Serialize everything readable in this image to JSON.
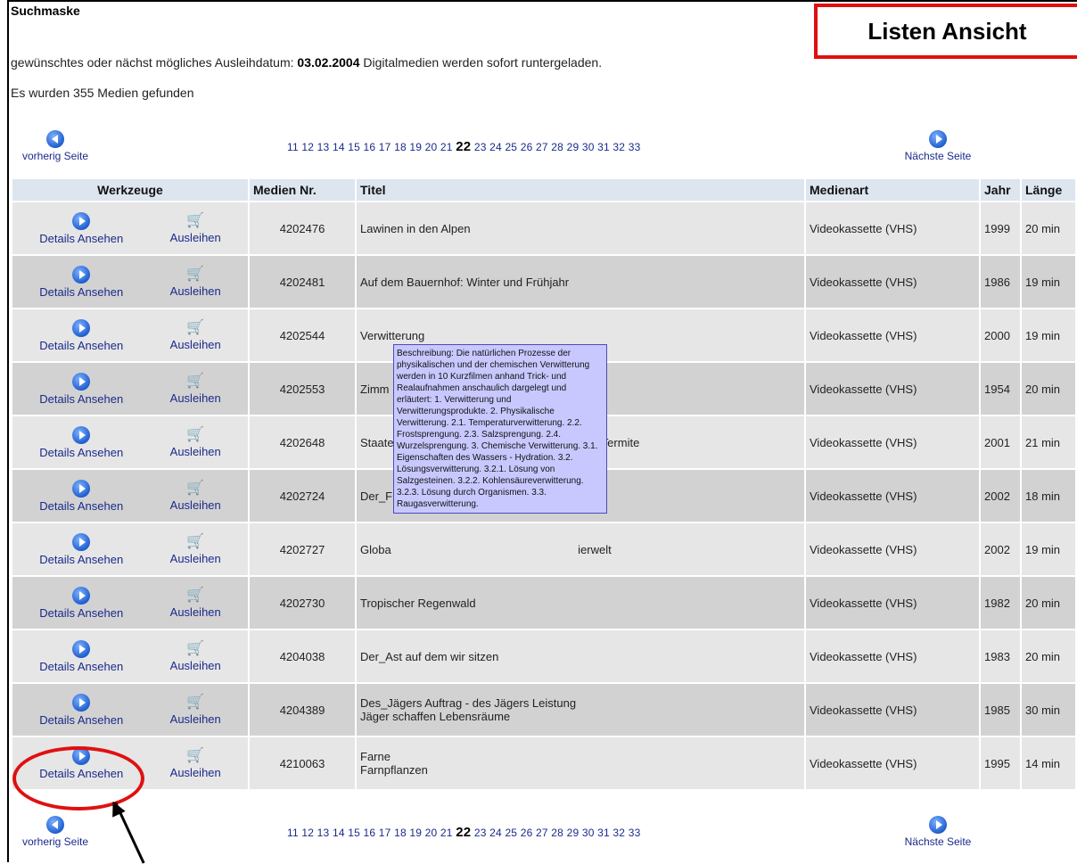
{
  "header": {
    "title": "Suchmaske",
    "view_label": "Listen Ansicht",
    "info_prefix": "gewünschtes oder nächst mögliches Ausleihdatum:",
    "info_date": "03.02.2004",
    "info_suffix": "Digitalmedien werden sofort runtergeladen.",
    "result_count": "Es wurden 355 Medien gefunden"
  },
  "pagination": {
    "prev_label": "vorherig Seite",
    "next_label": "Nächste Seite",
    "pages_before": "11 12 13 14 15 16 17 18 19 20 21",
    "current": "22",
    "pages_after": "23 24 25 26 27 28 29 30 31 32 33"
  },
  "table": {
    "headers": {
      "werkzeuge": "Werkzeuge",
      "nr": "Medien Nr.",
      "titel": "Titel",
      "art": "Medienart",
      "jahr": "Jahr",
      "laenge": "Länge"
    },
    "details_label": "Details Ansehen",
    "ausleihen_label": "Ausleihen",
    "rows": [
      {
        "nr": "4202476",
        "titel": "Lawinen in den Alpen",
        "titel2": "",
        "art": "Videokassette (VHS)",
        "jahr": "1999",
        "laenge": "20 min"
      },
      {
        "nr": "4202481",
        "titel": "Auf dem Bauernhof: Winter und Frühjahr",
        "titel2": "",
        "art": "Videokassette (VHS)",
        "jahr": "1986",
        "laenge": "19 min"
      },
      {
        "nr": "4202544",
        "titel": "Verwitterung",
        "titel2": "",
        "art": "Videokassette (VHS)",
        "jahr": "2000",
        "laenge": "19 min"
      },
      {
        "nr": "4202553",
        "titel": "Zimm",
        "titel2": "",
        "art": "Videokassette (VHS)",
        "jahr": "1954",
        "laenge": "20 min"
      },
      {
        "nr": "4202648",
        "titel": "Staate                                                          ise, Termite",
        "titel2": "",
        "art": "Videokassette (VHS)",
        "jahr": "2001",
        "laenge": "21 min"
      },
      {
        "nr": "4202724",
        "titel": "Der_F",
        "titel2": "",
        "art": "Videokassette (VHS)",
        "jahr": "2002",
        "laenge": "18 min"
      },
      {
        "nr": "4202727",
        "titel": "Globa                                                          ierwelt",
        "titel2": "",
        "art": "Videokassette (VHS)",
        "jahr": "2002",
        "laenge": "19 min"
      },
      {
        "nr": "4202730",
        "titel": "Tropischer Regenwald",
        "titel2": "",
        "art": "Videokassette (VHS)",
        "jahr": "1982",
        "laenge": "20 min"
      },
      {
        "nr": "4204038",
        "titel": "Der_Ast auf dem wir sitzen",
        "titel2": "",
        "art": "Videokassette (VHS)",
        "jahr": "1983",
        "laenge": "20 min"
      },
      {
        "nr": "4204389",
        "titel": "Des_Jägers Auftrag - des Jägers Leistung",
        "titel2": "Jäger schaffen Lebensräume",
        "art": "Videokassette (VHS)",
        "jahr": "1985",
        "laenge": "30 min"
      },
      {
        "nr": "4210063",
        "titel": "Farne",
        "titel2": "Farnpflanzen",
        "art": "Videokassette (VHS)",
        "jahr": "1995",
        "laenge": "14 min"
      }
    ]
  },
  "tooltip": "Beschreibung: Die natürlichen Prozesse der physikalischen und der chemischen Verwitterung werden in 10 Kurzfilmen anhand Trick- und Realaufnahmen anschaulich dargelegt und erläutert: 1. Verwitterung und Verwitterungsprodukte. 2. Physikalische Verwitterung. 2.1. Temperaturverwitterung. 2.2. Frostsprengung. 2.3. Salzsprengung. 2.4. Wurzelsprengung. 3. Chemische Verwitterung. 3.1. Eigenschaften des Wassers - Hydration. 3.2. Lösungsverwitterung. 3.2.1. Lösung von Salzgesteinen. 3.2.2. Kohlensäureverwitterung. 3.2.3. Lösung durch Organismen. 3.3. Raugasverwitterung.",
  "colors": {
    "highlight": "#e01010",
    "link": "#1a2a8a",
    "header_bg": "#dde5ef",
    "tooltip_bg": "#c8c8ff"
  },
  "icons": {
    "prev": "arrow-left-circle-icon",
    "next": "arrow-right-circle-icon",
    "details": "arrow-right-circle-icon",
    "ausleihen": "cart-icon"
  }
}
